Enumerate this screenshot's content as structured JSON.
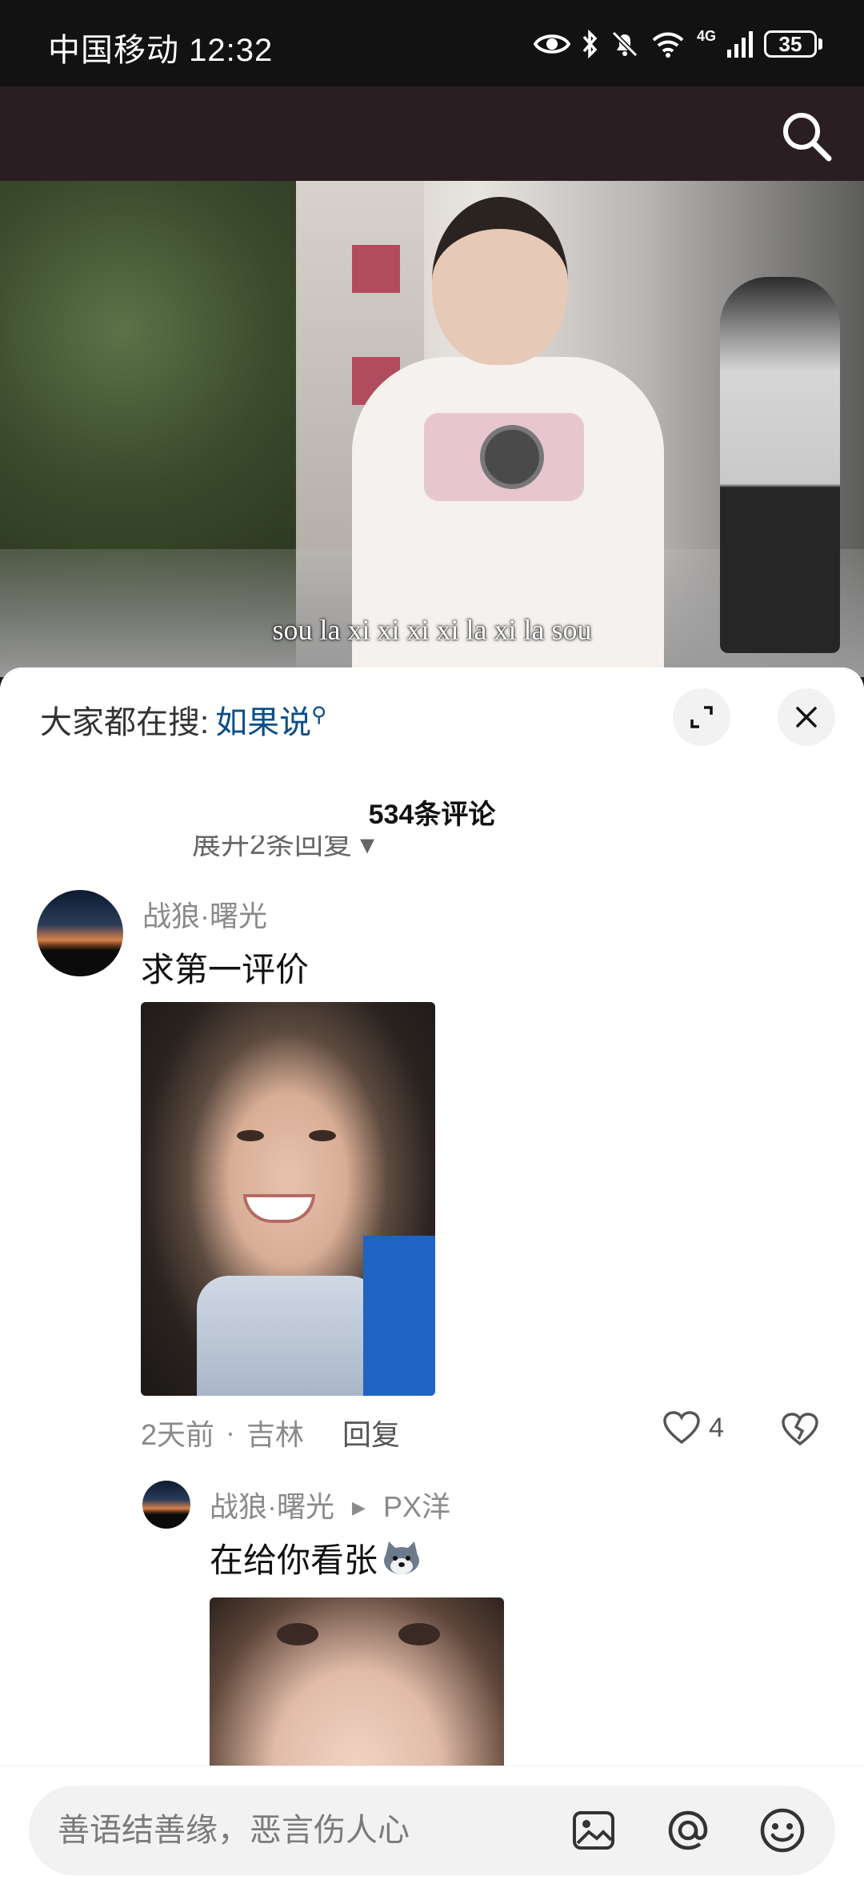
{
  "status_bar": {
    "carrier": "中国移动",
    "time": "12:32",
    "network": "4G",
    "battery": "35"
  },
  "video": {
    "subtitle": "sou la xi xi xi xi la xi la sou"
  },
  "comments_panel": {
    "hot_search_label": "大家都在搜:",
    "hot_search_keyword": "如果说",
    "comment_count": "534条评论",
    "hidden_replies_text": "展开2条回复"
  },
  "comments": [
    {
      "username": "战狼·曙光",
      "text": "求第一评价",
      "time": "2天前",
      "location": "吉林",
      "reply_label": "回复",
      "likes": "4"
    }
  ],
  "reply": {
    "username": "战狼·曙光",
    "reply_to": "PX洋",
    "text": "在给你看张",
    "emoji": "dog-emoji"
  },
  "input_bar": {
    "placeholder": "善语结善缘，恶言伤人心"
  }
}
